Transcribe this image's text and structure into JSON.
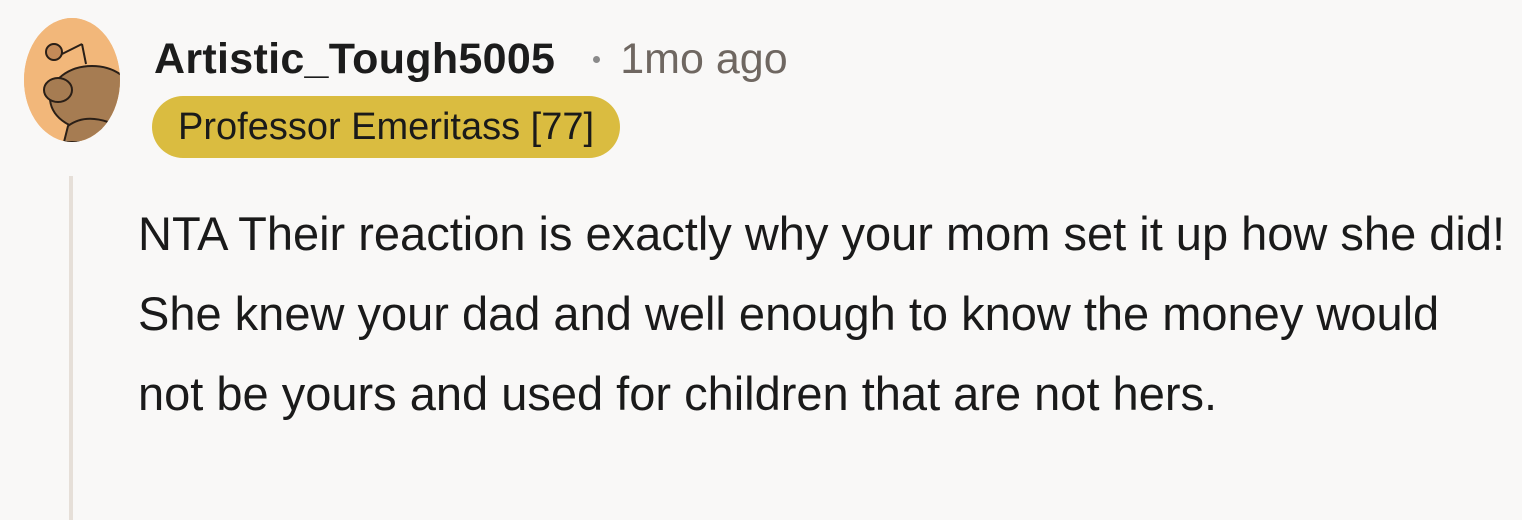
{
  "comment": {
    "author": "Artistic_Tough5005",
    "separator": "•",
    "timestamp": "1mo ago",
    "flair": "Professor Emeritass [77]",
    "body": "NTA Their reaction is exactly why your mom set it up how she did! She knew your dad and well enough to know the money would not be yours and used for children that are not hers."
  },
  "avatar": {
    "icon": "reddit-snoo-avatar-icon",
    "background_color": "#f2b77a",
    "figure_color": "#a67c52"
  },
  "colors": {
    "page_background": "#f9f8f7",
    "flair_background": "#dabc40",
    "timestamp_text": "#6f6761",
    "thread_line": "#e6dfd8"
  }
}
